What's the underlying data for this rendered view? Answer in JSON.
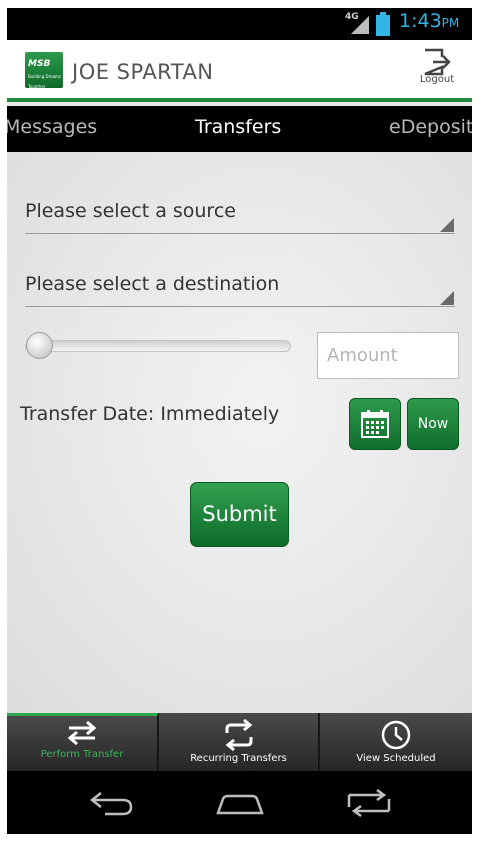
{
  "status_bar": {
    "network": "4G",
    "time": "1:43",
    "ampm": "PM"
  },
  "header": {
    "logo_text": "MSB",
    "logo_subtext": "Building Dreams Together",
    "user_name": "JOE SPARTAN",
    "logout_label": "Logout"
  },
  "tabs": [
    {
      "label": "Messages",
      "active": false
    },
    {
      "label": "Transfers",
      "active": true
    },
    {
      "label": "eDeposit",
      "active": false
    }
  ],
  "form": {
    "source_label": "Please select a source",
    "destination_label": "Please select a destination",
    "slider_level": 0,
    "amount_placeholder": "Amount",
    "amount_value": "",
    "transfer_date_label": "Transfer Date:",
    "transfer_date_value": "Immediately",
    "calendar_icon": "calendar-icon",
    "now_label": "Now",
    "submit_label": "Submit"
  },
  "bottom_actions": [
    {
      "label": "Perform Transfer",
      "icon": "swap-arrows-icon",
      "active": true
    },
    {
      "label": "Recurring Transfers",
      "icon": "recurring-arrows-icon",
      "active": false
    },
    {
      "label": "View Scheduled",
      "icon": "clock-icon",
      "active": false
    }
  ],
  "nav": {
    "back_icon": "back-icon",
    "home_icon": "home-icon",
    "recent_icon": "recent-apps-icon"
  },
  "colors": {
    "accent_green": "#1f8a3c",
    "status_blue": "#33b5e5",
    "active_tab_green": "#3cb55b"
  }
}
